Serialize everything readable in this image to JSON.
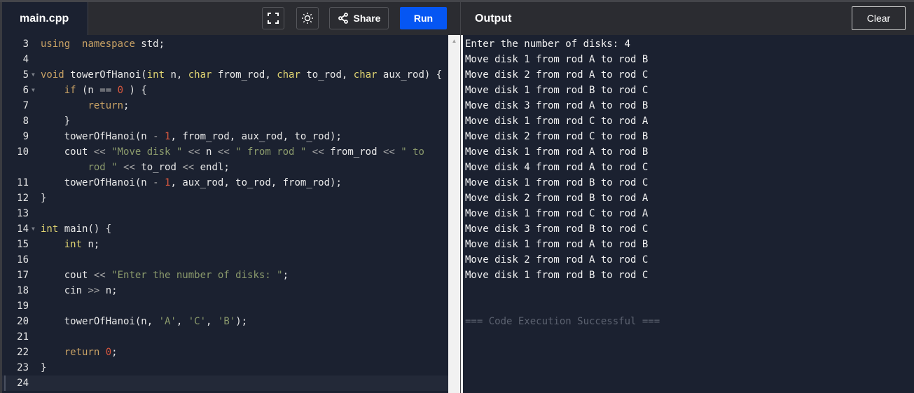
{
  "editor": {
    "tab": "main.cpp",
    "share_label": "Share",
    "run_label": "Run",
    "lines": [
      {
        "n": "3",
        "fold": false,
        "t": [
          [
            "kw",
            "using"
          ],
          [
            "",
            "  "
          ],
          [
            "kw",
            "namespace"
          ],
          [
            "",
            " std;"
          ]
        ]
      },
      {
        "n": "4",
        "fold": false,
        "t": []
      },
      {
        "n": "5",
        "fold": true,
        "t": [
          [
            "kw",
            "void"
          ],
          [
            "",
            " towerOfHanoi("
          ],
          [
            "ty",
            "int"
          ],
          [
            "",
            " n, "
          ],
          [
            "ty",
            "char"
          ],
          [
            "",
            " from_rod, "
          ],
          [
            "ty",
            "char"
          ],
          [
            "",
            " to_rod, "
          ],
          [
            "ty",
            "char"
          ],
          [
            "",
            " aux_rod) {"
          ]
        ]
      },
      {
        "n": "6",
        "fold": true,
        "t": [
          [
            "",
            "    "
          ],
          [
            "kw",
            "if"
          ],
          [
            "",
            " (n "
          ],
          [
            "op",
            "=="
          ],
          [
            "",
            " "
          ],
          [
            "num",
            "0"
          ],
          [
            "",
            " ) {"
          ]
        ]
      },
      {
        "n": "7",
        "fold": false,
        "t": [
          [
            "",
            "        "
          ],
          [
            "kw",
            "return"
          ],
          [
            "",
            ";"
          ]
        ]
      },
      {
        "n": "8",
        "fold": false,
        "t": [
          [
            "",
            "    }"
          ]
        ]
      },
      {
        "n": "9",
        "fold": false,
        "t": [
          [
            "",
            "    towerOfHanoi(n "
          ],
          [
            "op",
            "-"
          ],
          [
            "",
            " "
          ],
          [
            "num",
            "1"
          ],
          [
            "",
            ", from_rod, aux_rod, to_rod);"
          ]
        ]
      },
      {
        "n": "10",
        "fold": false,
        "t": [
          [
            "",
            "    cout "
          ],
          [
            "op",
            "<<"
          ],
          [
            "",
            " "
          ],
          [
            "str",
            "\"Move disk \""
          ],
          [
            "",
            " "
          ],
          [
            "op",
            "<<"
          ],
          [
            "",
            " n "
          ],
          [
            "op",
            "<<"
          ],
          [
            "",
            " "
          ],
          [
            "str",
            "\" from rod \""
          ],
          [
            "",
            " "
          ],
          [
            "op",
            "<<"
          ],
          [
            "",
            " from_rod "
          ],
          [
            "op",
            "<<"
          ],
          [
            "",
            " "
          ],
          [
            "str",
            "\" to"
          ]
        ]
      },
      {
        "n": "",
        "fold": false,
        "t": [
          [
            "",
            "        "
          ],
          [
            "str",
            "rod \""
          ],
          [
            "",
            " "
          ],
          [
            "op",
            "<<"
          ],
          [
            "",
            " to_rod "
          ],
          [
            "op",
            "<<"
          ],
          [
            "",
            " endl;"
          ]
        ]
      },
      {
        "n": "11",
        "fold": false,
        "t": [
          [
            "",
            "    towerOfHanoi(n "
          ],
          [
            "op",
            "-"
          ],
          [
            "",
            " "
          ],
          [
            "num",
            "1"
          ],
          [
            "",
            ", aux_rod, to_rod, from_rod);"
          ]
        ]
      },
      {
        "n": "12",
        "fold": false,
        "t": [
          [
            "",
            "}"
          ]
        ]
      },
      {
        "n": "13",
        "fold": false,
        "t": []
      },
      {
        "n": "14",
        "fold": true,
        "t": [
          [
            "ty",
            "int"
          ],
          [
            "",
            " main() {"
          ]
        ]
      },
      {
        "n": "15",
        "fold": false,
        "t": [
          [
            "",
            "    "
          ],
          [
            "ty",
            "int"
          ],
          [
            "",
            " n;"
          ]
        ]
      },
      {
        "n": "16",
        "fold": false,
        "t": []
      },
      {
        "n": "17",
        "fold": false,
        "t": [
          [
            "",
            "    cout "
          ],
          [
            "op",
            "<<"
          ],
          [
            "",
            " "
          ],
          [
            "str",
            "\"Enter the number of disks: \""
          ],
          [
            "",
            ";"
          ]
        ]
      },
      {
        "n": "18",
        "fold": false,
        "t": [
          [
            "",
            "    cin "
          ],
          [
            "op",
            ">>"
          ],
          [
            "",
            " n;"
          ]
        ]
      },
      {
        "n": "19",
        "fold": false,
        "t": []
      },
      {
        "n": "20",
        "fold": false,
        "t": [
          [
            "",
            "    towerOfHanoi(n, "
          ],
          [
            "str",
            "'A'"
          ],
          [
            "",
            ", "
          ],
          [
            "str",
            "'C'"
          ],
          [
            "",
            ", "
          ],
          [
            "str",
            "'B'"
          ],
          [
            "",
            ");"
          ]
        ]
      },
      {
        "n": "21",
        "fold": false,
        "t": []
      },
      {
        "n": "22",
        "fold": false,
        "t": [
          [
            "",
            "    "
          ],
          [
            "kw",
            "return"
          ],
          [
            "",
            " "
          ],
          [
            "num",
            "0"
          ],
          [
            "",
            ";"
          ]
        ]
      },
      {
        "n": "23",
        "fold": false,
        "t": [
          [
            "",
            "}"
          ]
        ]
      },
      {
        "n": "24",
        "fold": false,
        "t": [],
        "active": true
      }
    ]
  },
  "output": {
    "title": "Output",
    "clear_label": "Clear",
    "lines": [
      "Enter the number of disks: 4",
      "Move disk 1 from rod A to rod B",
      "Move disk 2 from rod A to rod C",
      "Move disk 1 from rod B to rod C",
      "Move disk 3 from rod A to rod B",
      "Move disk 1 from rod C to rod A",
      "Move disk 2 from rod C to rod B",
      "Move disk 1 from rod A to rod B",
      "Move disk 4 from rod A to rod C",
      "Move disk 1 from rod B to rod C",
      "Move disk 2 from rod B to rod A",
      "Move disk 1 from rod C to rod A",
      "Move disk 3 from rod B to rod C",
      "Move disk 1 from rod A to rod B",
      "Move disk 2 from rod A to rod C",
      "Move disk 1 from rod B to rod C"
    ],
    "status": "=== Code Execution Successful ==="
  }
}
